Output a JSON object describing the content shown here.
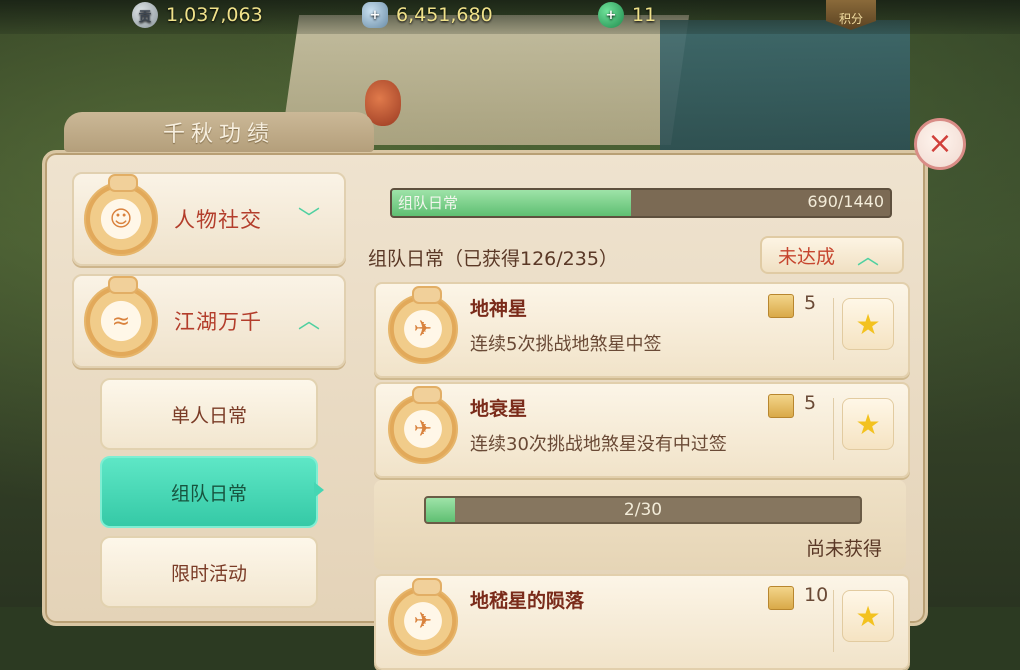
{
  "resources": {
    "contribution": {
      "icon": "contribution-coin-icon",
      "glyph": "贡",
      "value": "1,037,063"
    },
    "silver": {
      "icon": "silver-ingot-icon",
      "value": "6,451,680"
    },
    "jade": {
      "icon": "jade-currency-icon",
      "value": "11"
    },
    "points_label": "积分"
  },
  "window": {
    "title": "千秋功绩",
    "close_glyph": "×"
  },
  "sidebar": {
    "categories": [
      {
        "label": "人物社交",
        "expanded": false
      },
      {
        "label": "江湖万千",
        "expanded": true
      }
    ],
    "subitems": [
      {
        "label": "单人日常",
        "active": false
      },
      {
        "label": "组队日常",
        "active": true
      },
      {
        "label": "限时活动",
        "active": false
      }
    ]
  },
  "category_progress": {
    "label": "组队日常",
    "current": 690,
    "total": 1440,
    "text": "690/1440"
  },
  "section": {
    "title": "组队日常（已获得126/235）",
    "status": "未达成"
  },
  "achievements": [
    {
      "name": "地神星",
      "desc": "连续5次挑战地煞星中签",
      "points": "5"
    },
    {
      "name": "地衰星",
      "desc": "连续30次挑战地煞星没有中过签",
      "points": "5",
      "progress": {
        "current": 2,
        "total": 30,
        "text": "2/30"
      },
      "state": "尚未获得"
    },
    {
      "name": "地嵇星的陨落",
      "points": "10"
    }
  ],
  "colors": {
    "accent_teal": "#45d6b3",
    "title_red": "#b33d2b",
    "progress_green": "#5fbf72"
  }
}
